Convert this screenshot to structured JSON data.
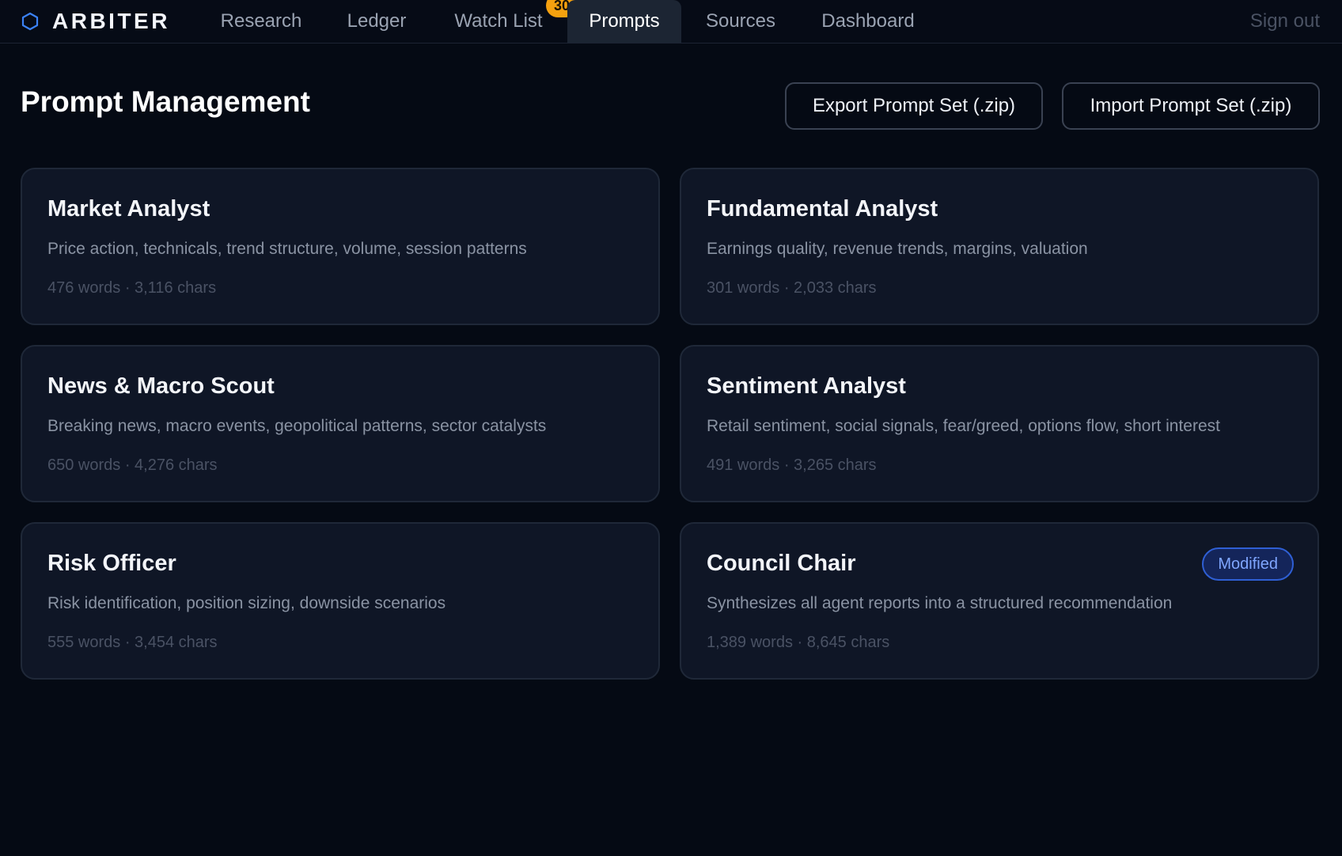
{
  "nav": {
    "brand": "ARBITER",
    "brand_icon": "hexagon-icon",
    "accent": "#3b82f6",
    "tabs": [
      {
        "label": "Research"
      },
      {
        "label": "Ledger"
      },
      {
        "label": "Watch List",
        "badge": "30"
      },
      {
        "label": "Prompts",
        "active": true
      },
      {
        "label": "Sources"
      },
      {
        "label": "Dashboard"
      }
    ],
    "sign_out": "Sign out"
  },
  "header": {
    "title": "Prompt Management",
    "export_label": "Export Prompt Set (.zip)",
    "import_label": "Import Prompt Set (.zip)"
  },
  "prompts": [
    {
      "title": "Market Analyst",
      "description": "Price action, technicals, trend structure, volume, session patterns",
      "meta": "476 words · 3,116 chars"
    },
    {
      "title": "Fundamental Analyst",
      "description": "Earnings quality, revenue trends, margins, valuation",
      "meta": "301 words · 2,033 chars"
    },
    {
      "title": "News & Macro Scout",
      "description": "Breaking news, macro events, geopolitical patterns, sector catalysts",
      "meta": "650 words · 4,276 chars"
    },
    {
      "title": "Sentiment Analyst",
      "description": "Retail sentiment, social signals, fear/greed, options flow, short interest",
      "meta": "491 words · 3,265 chars"
    },
    {
      "title": "Risk Officer",
      "description": "Risk identification, position sizing, downside scenarios",
      "meta": "555 words · 3,454 chars"
    },
    {
      "title": "Council Chair",
      "description": "Synthesizes all agent reports into a structured recommendation",
      "meta": "1,389 words · 8,645 chars",
      "badge": "Modified"
    }
  ],
  "colors": {
    "background": "#050a14",
    "card": "#0f1626",
    "badge_orange": "#f5a10f",
    "modified_badge": "#7fa6ff"
  }
}
